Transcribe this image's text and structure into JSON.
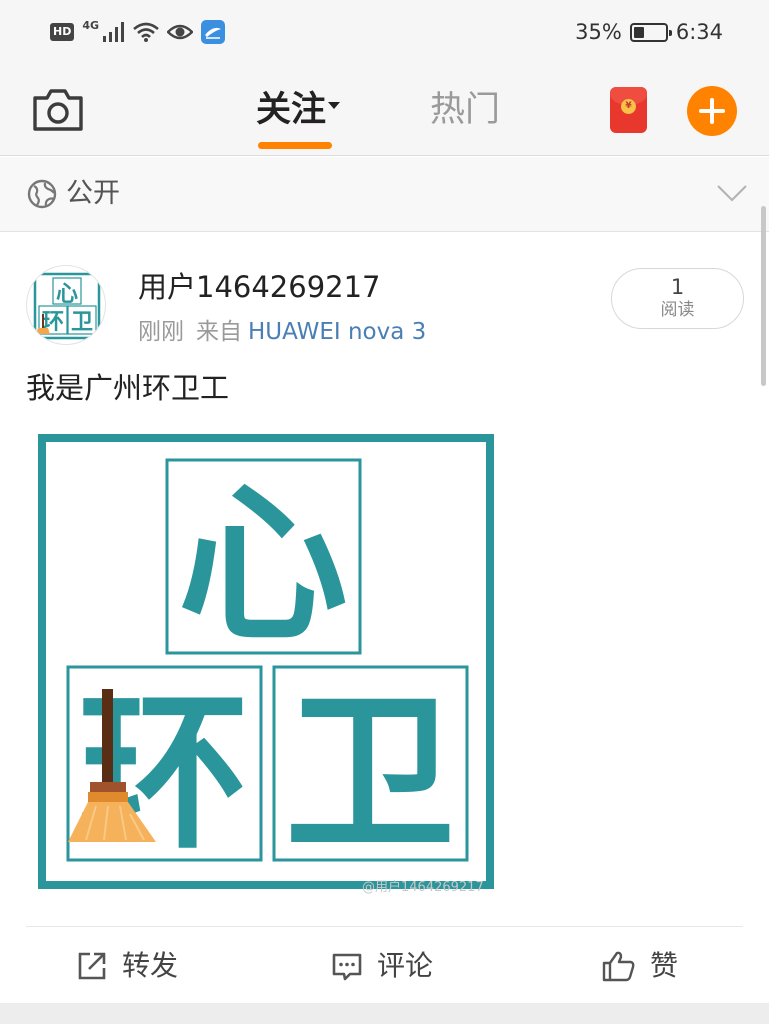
{
  "status_bar": {
    "hd": "HD",
    "network": "4G",
    "battery_percent": "35%",
    "battery_level": 0.35,
    "time": "6:34",
    "icons": [
      "signal-icon",
      "wifi-icon",
      "eye-icon",
      "app-notification-icon",
      "battery-icon"
    ]
  },
  "nav": {
    "tabs": [
      {
        "label": "关注",
        "active": true
      },
      {
        "label": "热门",
        "active": false
      }
    ],
    "accent_color": "#ff8200",
    "icons": [
      "camera-icon",
      "red-packet-icon",
      "add-icon"
    ]
  },
  "visibility": {
    "label": "公开",
    "icons": [
      "globe-icon",
      "chevron-down-icon"
    ]
  },
  "post": {
    "username": "用户1464269217",
    "time": "刚刚",
    "source_label": "来自",
    "source": "HUAWEI nova 3",
    "read_count": "1",
    "read_label": "阅读",
    "text": "我是广州环卫工",
    "image": {
      "characters": [
        "心",
        "环",
        "卫"
      ],
      "primary_color": "#2a969b",
      "watermark": "@用户1464269217"
    }
  },
  "actions": [
    {
      "label": "转发",
      "icon": "repost-icon"
    },
    {
      "label": "评论",
      "icon": "comment-icon"
    },
    {
      "label": "赞",
      "icon": "like-icon"
    }
  ],
  "link_color": "#4a7fb5"
}
